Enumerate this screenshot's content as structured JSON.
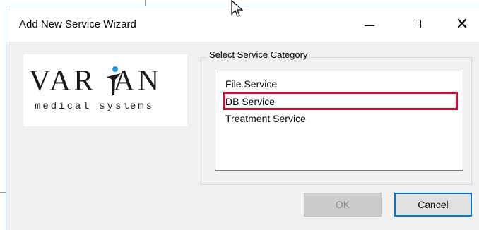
{
  "window": {
    "title": "Add New Service Wizard",
    "controls": {
      "minimize_icon": "minimize-icon",
      "maximize_icon": "maximize-icon",
      "close_icon": "close-icon",
      "close_glyph": "✕"
    }
  },
  "logo": {
    "brand": "VARIAN",
    "tagline": "medical systems"
  },
  "category_group": {
    "label": "Select Service Category",
    "items": [
      "File Service",
      "DB Service",
      "Treatment Service"
    ],
    "highlighted_item": "DB Service",
    "highlight_color": "#c8102e"
  },
  "buttons": {
    "ok": "OK",
    "cancel": "Cancel",
    "ok_enabled": false
  },
  "colors": {
    "accent": "#0078d7",
    "dialog_bg": "#f0f0f0"
  }
}
